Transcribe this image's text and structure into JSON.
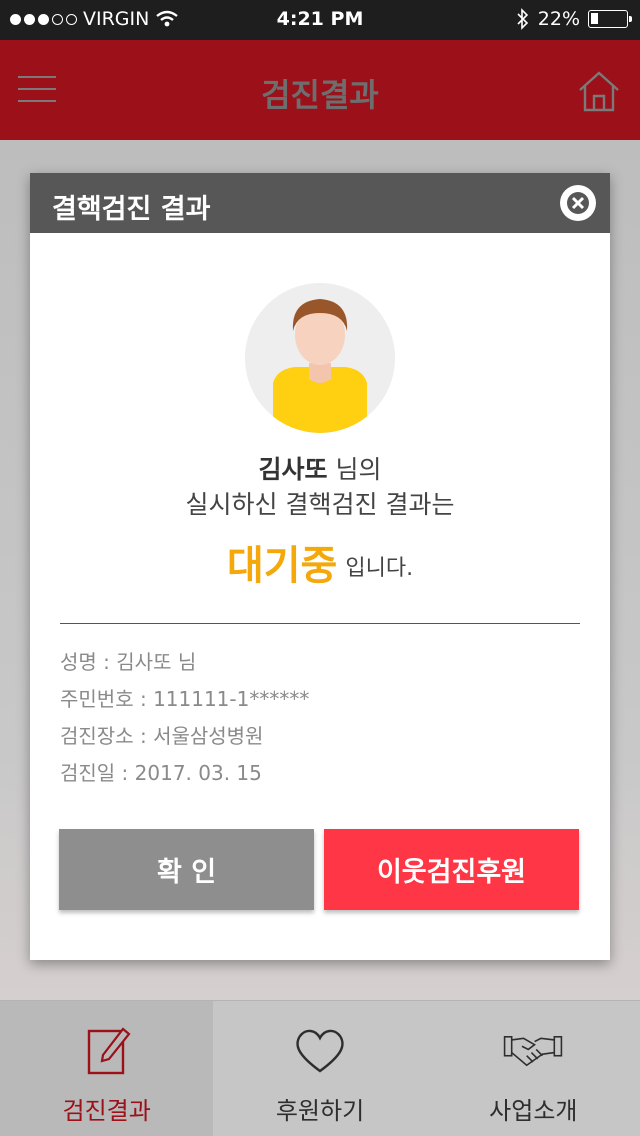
{
  "status_bar": {
    "carrier": "VIRGIN",
    "time": "4:21 PM",
    "battery_percent": "22%",
    "battery_level": 0.22,
    "signal_dots_filled": 3,
    "signal_dots_total": 5,
    "icons": [
      "wifi-icon",
      "bluetooth-icon",
      "battery-icon"
    ]
  },
  "header": {
    "title": "검진결과",
    "menu_icon": "hamburger-menu-icon",
    "home_icon": "home-icon"
  },
  "modal": {
    "title": "결핵검진 결과",
    "close_icon": "close-icon",
    "avatar_icon": "user-avatar-icon",
    "user_name": "김사또",
    "suffix_line1": " 님의",
    "line2": "실시하신 결핵검진 결과는",
    "status": "대기중",
    "status_suffix": "입니다.",
    "colors": {
      "status": "#f4a80c",
      "header": "#575757"
    },
    "info": [
      {
        "label": "성명 : ",
        "value": "김사또 님"
      },
      {
        "label": "주민번호 : ",
        "value": "111111-1******"
      },
      {
        "label": "검진장소 :  ",
        "value": "서울삼성병원"
      },
      {
        "label": "검진일 :  ",
        "value": "2017. 03. 15"
      }
    ],
    "buttons": {
      "confirm": "확 인",
      "support": "이웃검진후원",
      "colors": {
        "confirm": "#8e8e8e",
        "support": "#ff3646"
      }
    }
  },
  "tabbar": {
    "tabs": [
      {
        "label": "검진결과",
        "icon": "edit-document-icon",
        "active": true
      },
      {
        "label": "후원하기",
        "icon": "heart-icon",
        "active": false
      },
      {
        "label": "사업소개",
        "icon": "handshake-icon",
        "active": false
      }
    ],
    "active_color": "#9b1019"
  }
}
